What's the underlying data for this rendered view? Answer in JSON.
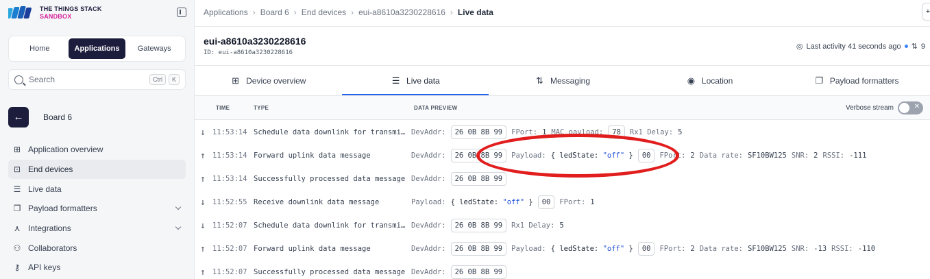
{
  "brand": {
    "line1": "THE THINGS STACK",
    "line2": "SANDBOX",
    "accent": "#d41f9a",
    "dark": "#1c1c3c"
  },
  "top_nav": {
    "home": "Home",
    "applications": "Applications",
    "gateways": "Gateways"
  },
  "search": {
    "placeholder": "Search",
    "key1": "Ctrl",
    "key2": "K"
  },
  "app": {
    "name": "Board 6"
  },
  "sidebar": {
    "items": [
      {
        "label": "Application overview"
      },
      {
        "label": "End devices"
      },
      {
        "label": "Live data"
      },
      {
        "label": "Payload formatters"
      },
      {
        "label": "Integrations"
      },
      {
        "label": "Collaborators"
      },
      {
        "label": "API keys"
      }
    ]
  },
  "breadcrumb": {
    "b1": "Applications",
    "b2": "Board 6",
    "b3": "End devices",
    "b4": "eui-a8610a3230228616",
    "current": "Live data"
  },
  "device": {
    "title": "eui-a8610a3230228616",
    "id": "ID: eui-a8610a3230228616",
    "activity": "Last activity 41 seconds ago",
    "traffic": "9"
  },
  "tabs": {
    "overview": "Device overview",
    "live": "Live data",
    "messaging": "Messaging",
    "location": "Location",
    "formatters": "Payload formatters"
  },
  "table": {
    "col_time": "TIME",
    "col_type": "TYPE",
    "col_preview": "DATA PREVIEW",
    "verbose": "Verbose stream",
    "rows": [
      {
        "dir": "↓",
        "time": "11:53:14",
        "type": "Schedule data downlink for transmission",
        "devaddr_key": "DevAddr:",
        "devaddr": "26 0B 8B 99",
        "fport_key": "FPort:",
        "fport": "1",
        "mac_key": "MAC payload:",
        "mac": "78",
        "rx1_key": "Rx1 Delay:",
        "rx1": "5"
      },
      {
        "dir": "↑",
        "time": "11:53:14",
        "type": "Forward uplink data message",
        "devaddr_key": "DevAddr:",
        "devaddr": "26 0B 8B 99",
        "payload_key": "Payload:",
        "payload_open": "{ ledState: ",
        "payload_val": "\"off\"",
        "payload_close": " }",
        "payload_hex": "00",
        "fport_key": "FPort:",
        "fport": "2",
        "rate_key": "Data rate:",
        "rate": "SF10BW125",
        "snr_key": "SNR:",
        "snr": "2",
        "rssi_key": "RSSI:",
        "rssi": "-111"
      },
      {
        "dir": "↑",
        "time": "11:53:14",
        "type": "Successfully processed data message",
        "devaddr_key": "DevAddr:",
        "devaddr": "26 0B 8B 99"
      },
      {
        "dir": "↓",
        "time": "11:52:55",
        "type": "Receive downlink data message",
        "payload_key": "Payload:",
        "payload_open": "{ ledState: ",
        "payload_val": "\"off\"",
        "payload_close": " }",
        "payload_hex": "00",
        "fport_key": "FPort:",
        "fport": "1"
      },
      {
        "dir": "↓",
        "time": "11:52:07",
        "type": "Schedule data downlink for transmission",
        "devaddr_key": "DevAddr:",
        "devaddr": "26 0B 8B 99",
        "rx1_key": "Rx1 Delay:",
        "rx1": "5"
      },
      {
        "dir": "↑",
        "time": "11:52:07",
        "type": "Forward uplink data message",
        "devaddr_key": "DevAddr:",
        "devaddr": "26 0B 8B 99",
        "payload_key": "Payload:",
        "payload_open": "{ ledState: ",
        "payload_val": "\"off\"",
        "payload_close": " }",
        "payload_hex": "00",
        "fport_key": "FPort:",
        "fport": "2",
        "rate_key": "Data rate:",
        "rate": "SF10BW125",
        "snr_key": "SNR:",
        "snr": "-13",
        "rssi_key": "RSSI:",
        "rssi": "-110"
      },
      {
        "dir": "↑",
        "time": "11:52:07",
        "type": "Successfully processed data message",
        "devaddr_key": "DevAddr:",
        "devaddr": "26 0B 8B 99"
      }
    ]
  },
  "colors": {
    "annotation": "#e11d1d",
    "tab_active": "#2563eb"
  }
}
